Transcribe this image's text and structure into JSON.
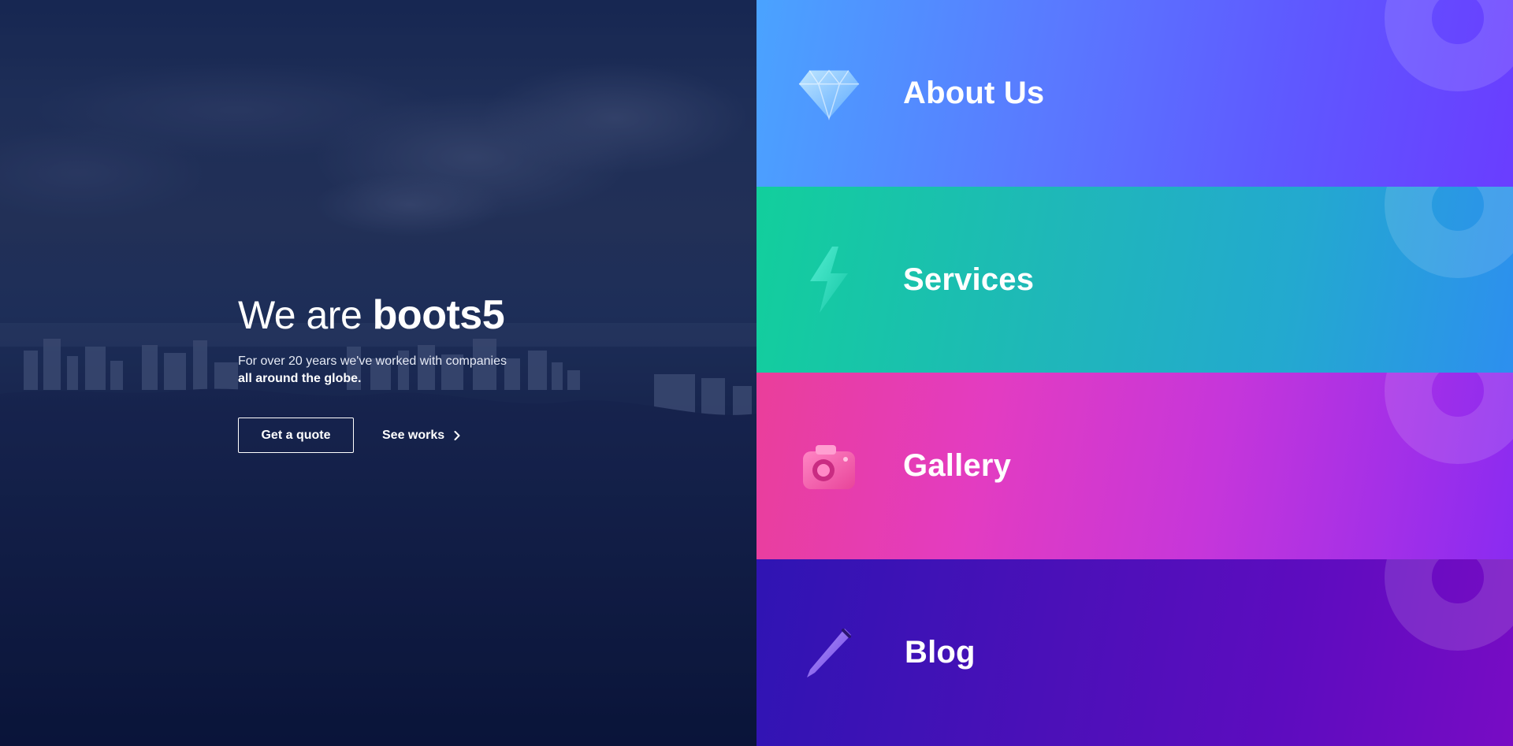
{
  "hero": {
    "title_prefix": "We are",
    "brand": "boots5",
    "subtitle_line1": "For over 20 years we've worked with companies",
    "subtitle_line2": "all around the globe.",
    "cta_primary": "Get a quote",
    "cta_secondary": "See works"
  },
  "panels": [
    {
      "label": "About Us",
      "icon": "diamond-icon",
      "gradient": [
        "#4aa3ff",
        "#6a3dff"
      ]
    },
    {
      "label": "Services",
      "icon": "lightning-icon",
      "gradient": [
        "#12cf9c",
        "#2d8fef"
      ]
    },
    {
      "label": "Gallery",
      "icon": "camera-icon",
      "gradient": [
        "#ea3e9a",
        "#8a2bf1"
      ]
    },
    {
      "label": "Blog",
      "icon": "pen-icon",
      "gradient": [
        "#2f14b3",
        "#780cc4"
      ]
    }
  ],
  "colors": {
    "hero_bg": "#0b163c",
    "text": "#ffffff"
  }
}
